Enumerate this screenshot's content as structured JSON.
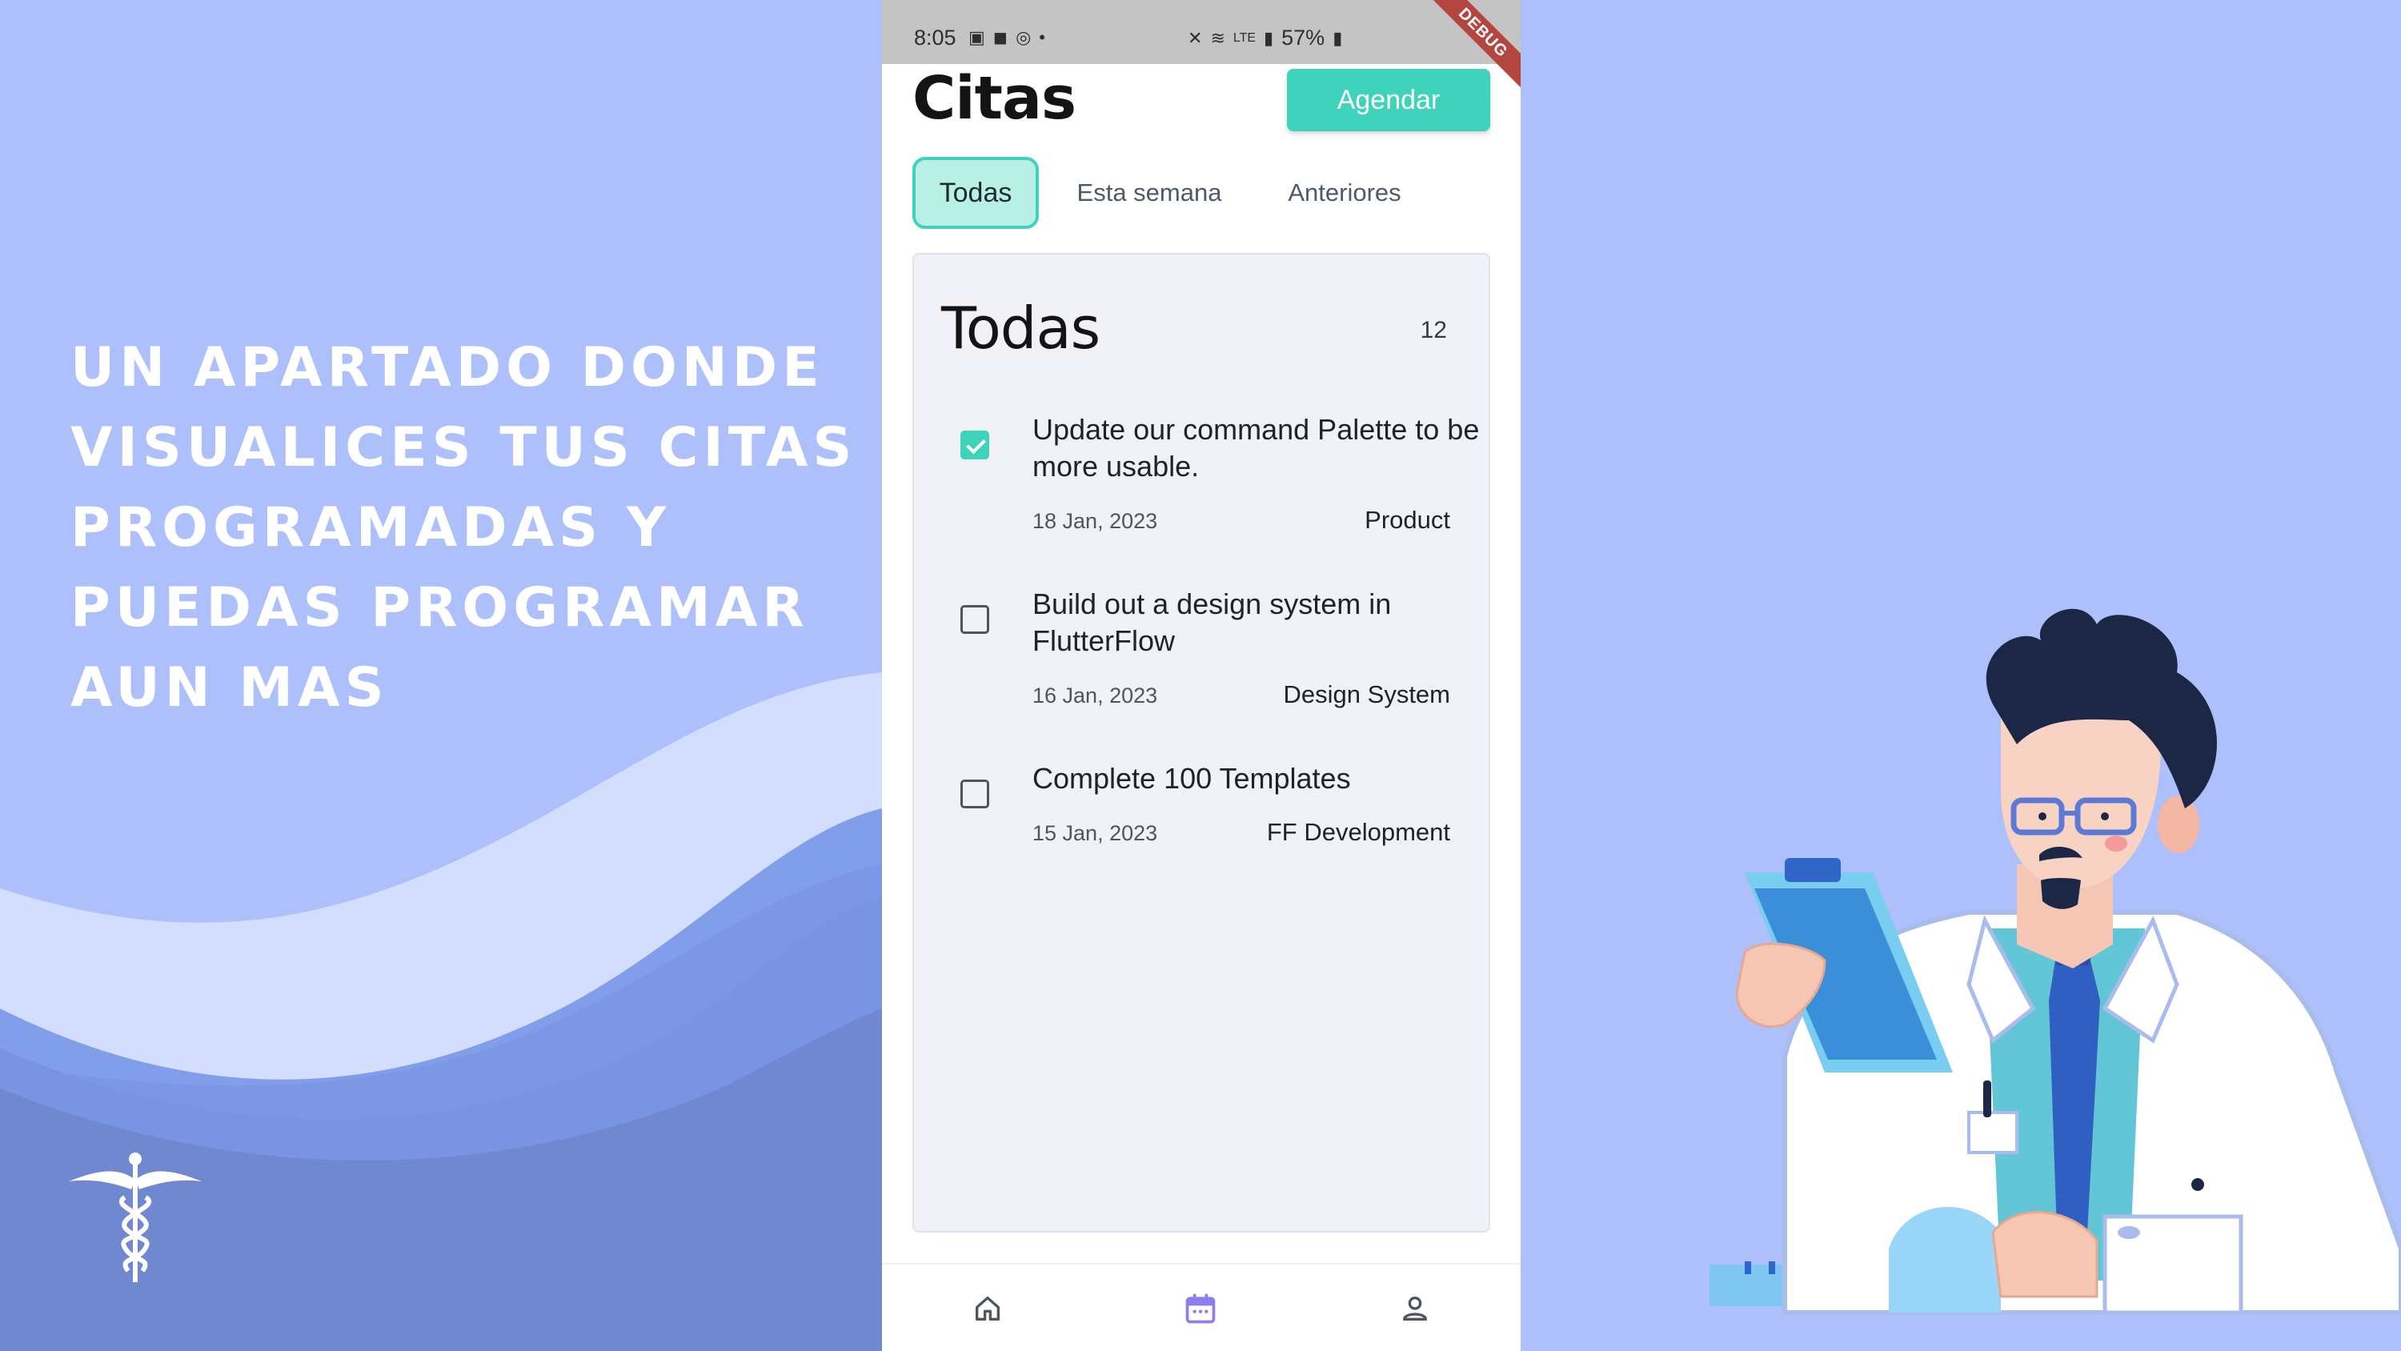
{
  "promo": {
    "headline": "Un apartado donde visualices tus citas programadas y puedas programar aun mas"
  },
  "status_bar": {
    "time": "8:05",
    "battery": "57%",
    "debug_label": "DEBUG"
  },
  "header": {
    "title": "Citas",
    "schedule_button": "Agendar"
  },
  "tabs": [
    {
      "label": "Todas",
      "active": true
    },
    {
      "label": "Esta semana",
      "active": false
    },
    {
      "label": "Anteriores",
      "active": false
    }
  ],
  "list": {
    "title": "Todas",
    "count": "12",
    "items": [
      {
        "title": "Update our command Palette to be more usable.",
        "date": "18 Jan, 2023",
        "tag": "Product",
        "checked": true
      },
      {
        "title": "Build out a design system in FlutterFlow",
        "date": "16 Jan, 2023",
        "tag": "Design System",
        "checked": false
      },
      {
        "title": "Complete 100 Templates",
        "date": "15 Jan, 2023",
        "tag": "FF Development",
        "checked": false
      }
    ]
  },
  "bottom_nav": [
    {
      "icon": "home-icon",
      "active": false
    },
    {
      "icon": "calendar-icon",
      "active": true
    },
    {
      "icon": "user-icon",
      "active": false
    }
  ],
  "colors": {
    "background": "#adc0fb",
    "accent": "#3ed3ba",
    "nav_active": "#8c7df0",
    "debug_ribbon": "#b5463f"
  }
}
